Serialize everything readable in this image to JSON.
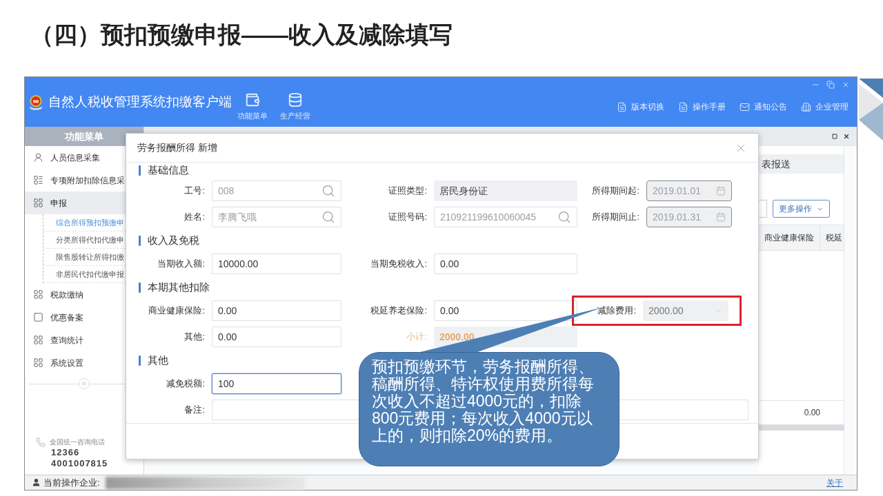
{
  "slide_title": "（四）预扣预缴申报——收入及减除填写",
  "app": {
    "title": "自然人税收管理系统扣缴客户端",
    "toolbar": [
      {
        "label": "功能菜单",
        "kind": "wallet"
      },
      {
        "label": "生产经营",
        "kind": "coins"
      }
    ],
    "links": [
      {
        "label": "版本切换",
        "kind": "doc"
      },
      {
        "label": "操作手册",
        "kind": "doc"
      },
      {
        "label": "通知公告",
        "kind": "mail"
      },
      {
        "label": "企业管理",
        "kind": "building"
      }
    ],
    "sidebar": {
      "title": "功能菜单",
      "items": [
        {
          "label": "人员信息采集",
          "kind": "person",
          "selected": false
        },
        {
          "label": "专项附加扣除信息采",
          "kind": "list",
          "selected": false
        },
        {
          "label": "申报",
          "kind": "grid",
          "selected": true,
          "expanded": true,
          "children": [
            {
              "label": "综合所得预扣预缴申",
              "selected": true
            },
            {
              "label": "分类所得代扣代缴申",
              "selected": false
            },
            {
              "label": "限售股转让所得扣缴",
              "selected": false
            },
            {
              "label": "非居民代扣代缴申报",
              "selected": false
            }
          ]
        },
        {
          "label": "税款缴纳",
          "kind": "grid",
          "selected": false
        },
        {
          "label": "优惠备案",
          "kind": "page",
          "selected": false
        },
        {
          "label": "查询统计",
          "kind": "grid",
          "selected": false
        },
        {
          "label": "系统设置",
          "kind": "grid",
          "selected": false
        }
      ],
      "hotline": {
        "label": "全国统一咨询电话",
        "numbers": [
          "12366",
          "4001007815"
        ]
      }
    },
    "background": {
      "tab": "表报送",
      "more_button": "更多操作",
      "columns": [
        "商业健康保险",
        "税延"
      ],
      "total": "0.00"
    },
    "status_bar": {
      "label": "当前操作企业:",
      "link": "关于"
    }
  },
  "dialog": {
    "title": "劳务报酬所得 新增",
    "sections": [
      {
        "title": "基础信息",
        "rows": [
          [
            {
              "label": "工号:",
              "value": "008",
              "kind": "search",
              "focused": false,
              "highlighted": false
            },
            {
              "label": "证照类型:",
              "value": "居民身份证",
              "kind": "readonly",
              "focused": false,
              "highlighted": false
            },
            {
              "label": "所得期间起:",
              "value": "2019.01.01",
              "kind": "date",
              "focused": false,
              "highlighted": false
            }
          ],
          [
            {
              "label": "姓名:",
              "value": "李腾飞哦",
              "kind": "search",
              "focused": false,
              "highlighted": false
            },
            {
              "label": "证照号码:",
              "value": "210921199610060045",
              "kind": "search",
              "focused": false,
              "highlighted": false
            },
            {
              "label": "所得期间止:",
              "value": "2019.01.31",
              "kind": "date",
              "focused": false,
              "highlighted": false
            }
          ]
        ]
      },
      {
        "title": "收入及免税",
        "rows": [
          [
            {
              "label": "当期收入额:",
              "value": "10000.00",
              "kind": "input",
              "focused": false,
              "highlighted": false
            },
            {
              "label": "当期免税收入:",
              "value": "0.00",
              "kind": "input",
              "focused": false,
              "highlighted": false
            }
          ]
        ]
      },
      {
        "title": "本期其他扣除",
        "rows": [
          [
            {
              "label": "商业健康保险:",
              "value": "0.00",
              "kind": "input",
              "focused": false,
              "highlighted": false
            },
            {
              "label": "税延养老保险:",
              "value": "0.00",
              "kind": "input",
              "focused": false,
              "highlighted": false
            },
            {
              "label": "减除费用:",
              "value": "2000.00",
              "kind": "select",
              "focused": false,
              "highlighted": true
            }
          ],
          [
            {
              "label": "其他:",
              "value": "0.00",
              "kind": "input",
              "focused": false,
              "highlighted": false
            },
            {
              "label": "小计:",
              "value": "2000.00",
              "kind": "subtotal",
              "focused": false,
              "highlighted": false
            }
          ]
        ]
      },
      {
        "title": "其他",
        "rows": [
          [
            {
              "label": "减免税额:",
              "value": "100",
              "kind": "input",
              "focused": true,
              "highlighted": false
            }
          ],
          [
            {
              "label": "备注:",
              "kind": "wide",
              "focused": false,
              "highlighted": false
            }
          ]
        ]
      }
    ]
  },
  "callout": "预扣预缴环节，劳务报酬所得、稿酬所得、特许权使用费所得每次收入不超过4000元的，扣除800元费用；每次收入4000元以上的，则扣除20%的费用。"
}
